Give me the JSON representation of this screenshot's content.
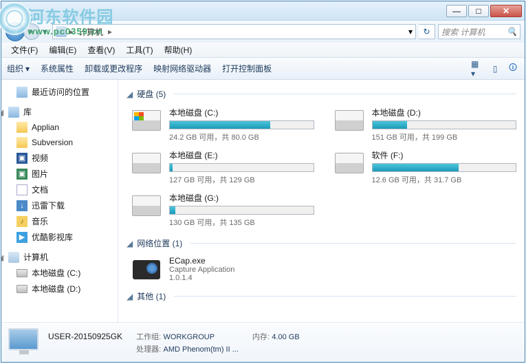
{
  "watermark": {
    "line1": "河东软件园",
    "line2": "www.pc0359.cn"
  },
  "titlebar": {
    "min": "—",
    "max": "□",
    "close": "✕"
  },
  "address": {
    "seg_computer": "计算机",
    "seg_sep": "▸",
    "refresh": "↻",
    "dropdown": "▾"
  },
  "search": {
    "placeholder": "搜索 计算机",
    "icon": "🔍"
  },
  "menu": {
    "file": "文件(F)",
    "edit": "编辑(E)",
    "view": "查看(V)",
    "tools": "工具(T)",
    "help": "帮助(H)"
  },
  "toolbar": {
    "organize": "组织",
    "props": "系统属性",
    "uninstall": "卸载或更改程序",
    "mapnet": "映射网络驱动器",
    "ctrlpanel": "打开控制面板"
  },
  "sidebar": {
    "recent": "最近访问的位置",
    "libraries": "库",
    "items": [
      {
        "label": "Applian"
      },
      {
        "label": "Subversion"
      },
      {
        "label": "视频"
      },
      {
        "label": "图片"
      },
      {
        "label": "文档"
      },
      {
        "label": "迅雷下载"
      },
      {
        "label": "音乐"
      },
      {
        "label": "优酷影视库"
      }
    ],
    "computer": "计算机",
    "drive_c": "本地磁盘 (C:)",
    "drive_d": "本地磁盘 (D:)"
  },
  "content": {
    "group_drives": "硬盘 (5)",
    "group_netloc": "网络位置 (1)",
    "group_other": "其他 (1)",
    "drives": [
      {
        "name": "本地磁盘 (C:)",
        "stat": "24.2 GB 可用，共 80.0 GB",
        "fill": 70,
        "win": true
      },
      {
        "name": "本地磁盘 (D:)",
        "stat": "151 GB 可用，共 199 GB",
        "fill": 24,
        "win": false
      },
      {
        "name": "本地磁盘 (E:)",
        "stat": "127 GB 可用，共 129 GB",
        "fill": 2,
        "win": false
      },
      {
        "name": "软件 (F:)",
        "stat": "12.6 GB 可用，共 31.7 GB",
        "fill": 60,
        "win": false
      },
      {
        "name": "本地磁盘 (G:)",
        "stat": "130 GB 可用，共 135 GB",
        "fill": 4,
        "win": false
      }
    ],
    "netloc": {
      "name": "ECap.exe",
      "desc": "Capture Application",
      "ver": "1.0.1.4"
    }
  },
  "details": {
    "name": "USER-20150925GK",
    "workgroup_lbl": "工作组:",
    "workgroup": "WORKGROUP",
    "mem_lbl": "内存:",
    "mem": "4.00 GB",
    "cpu_lbl": "处理器:",
    "cpu": "AMD Phenom(tm) II ..."
  }
}
